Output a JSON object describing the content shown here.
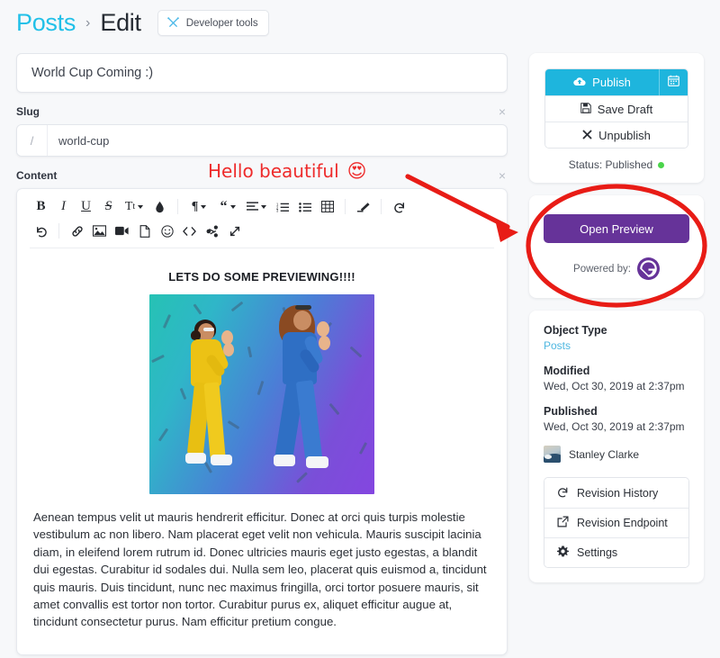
{
  "header": {
    "breadcrumb_root": "Posts",
    "breadcrumb_sep": "›",
    "breadcrumb_current": "Edit",
    "devtools_label": "Developer tools",
    "devtools_icon": "tools-icon"
  },
  "fields": {
    "title_value": "World Cup Coming :)",
    "slug_label": "Slug",
    "slug_prefix": "/",
    "slug_value": "world-cup",
    "content_label": "Content",
    "close_icon": "×"
  },
  "toolbar": {
    "row1": [
      {
        "name": "bold-button",
        "glyph": "B",
        "style": "bold",
        "caret": false
      },
      {
        "name": "italic-button",
        "glyph": "I",
        "style": "italic",
        "caret": false
      },
      {
        "name": "underline-button",
        "glyph": "U",
        "style": "underline",
        "caret": false
      },
      {
        "name": "strikethrough-button",
        "glyph": "S",
        "style": "strike",
        "caret": false
      },
      {
        "name": "text-size-button",
        "glyph": "Tt",
        "style": "plain",
        "caret": true
      },
      {
        "name": "text-color-button",
        "glyph": "◆",
        "style": "drop",
        "caret": false
      },
      {
        "name": "paragraph-style-button",
        "glyph": "¶",
        "style": "plain",
        "caret": true
      },
      {
        "name": "blockquote-button",
        "glyph": "“",
        "style": "quote",
        "caret": true
      },
      {
        "name": "align-button",
        "glyph": "≡",
        "style": "plain",
        "caret": true
      },
      {
        "name": "ordered-list-button",
        "glyph": "ol",
        "style": "svg",
        "caret": false
      },
      {
        "name": "unordered-list-button",
        "glyph": "ul",
        "style": "svg",
        "caret": false
      },
      {
        "name": "table-button",
        "glyph": "table",
        "style": "svg",
        "caret": false
      },
      {
        "name": "clear-format-button",
        "glyph": "eraser",
        "style": "svg",
        "caret": false
      },
      {
        "name": "undo-button",
        "glyph": "undo",
        "style": "svg",
        "caret": false
      }
    ],
    "row2": [
      {
        "name": "redo-button",
        "glyph": "redo",
        "style": "svg"
      },
      {
        "name": "link-button",
        "glyph": "link",
        "style": "svg"
      },
      {
        "name": "image-button",
        "glyph": "image",
        "style": "svg"
      },
      {
        "name": "video-button",
        "glyph": "video",
        "style": "svg"
      },
      {
        "name": "file-button",
        "glyph": "file",
        "style": "svg"
      },
      {
        "name": "emoji-button",
        "glyph": "emoji",
        "style": "svg"
      },
      {
        "name": "code-button",
        "glyph": "code",
        "style": "svg"
      },
      {
        "name": "share-button",
        "glyph": "share",
        "style": "svg"
      },
      {
        "name": "fullscreen-button",
        "glyph": "expand",
        "style": "svg"
      }
    ]
  },
  "document": {
    "heading": "LETS DO SOME PREVIEWING!!!!",
    "image_alt": "two dancers on gradient background",
    "paragraph": "Aenean tempus velit ut mauris hendrerit efficitur. Donec at orci quis turpis molestie vestibulum ac non libero. Nam placerat eget velit non vehicula. Mauris suscipit lacinia diam, in eleifend lorem rutrum id. Donec ultricies mauris eget justo egestas, a blandit dui egestas. Curabitur id sodales dui. Nulla sem leo, placerat quis euismod a, tincidunt quis mauris. Duis tincidunt, nunc nec maximus fringilla, orci tortor posuere mauris, sit amet convallis est tortor non tortor. Curabitur purus ex, aliquet efficitur augue at, tincidunt consectetur purus. Nam efficitur pretium congue."
  },
  "publish_panel": {
    "publish_label": "Publish",
    "publish_icon": "cloud-upload-icon",
    "schedule_icon": "calendar-icon",
    "save_draft_label": "Save Draft",
    "save_draft_icon": "floppy-disk-icon",
    "unpublish_label": "Unpublish",
    "unpublish_icon": "close-x-icon",
    "status_label": "Status: Published",
    "status_color": "#4bd44b",
    "accent_color": "#1eb5dd"
  },
  "preview_panel": {
    "button_label": "Open Preview",
    "button_color": "#663399",
    "powered_label": "Powered by:",
    "logo_icon": "gatsby-logo-icon"
  },
  "meta_panel": {
    "object_type_label": "Object Type",
    "object_type_value": "Posts",
    "modified_label": "Modified",
    "modified_value": "Wed, Oct 30, 2019 at 2:37pm",
    "published_label": "Published",
    "published_value": "Wed, Oct 30, 2019 at 2:37pm",
    "author_name": "Stanley Clarke",
    "author_avatar_icon": "user-avatar",
    "actions": [
      {
        "label": "Revision History",
        "icon": "history-icon",
        "name": "revision-history-button"
      },
      {
        "label": "Revision Endpoint",
        "icon": "external-link-icon",
        "name": "revision-endpoint-button"
      },
      {
        "label": "Settings",
        "icon": "gear-icon",
        "name": "settings-button"
      }
    ]
  },
  "annotation": {
    "text": "Hello beautiful",
    "emoji": "😍",
    "color": "#ee2b2b",
    "arrow_icon": "red-arrow",
    "circle_icon": "red-ellipse-highlight"
  }
}
